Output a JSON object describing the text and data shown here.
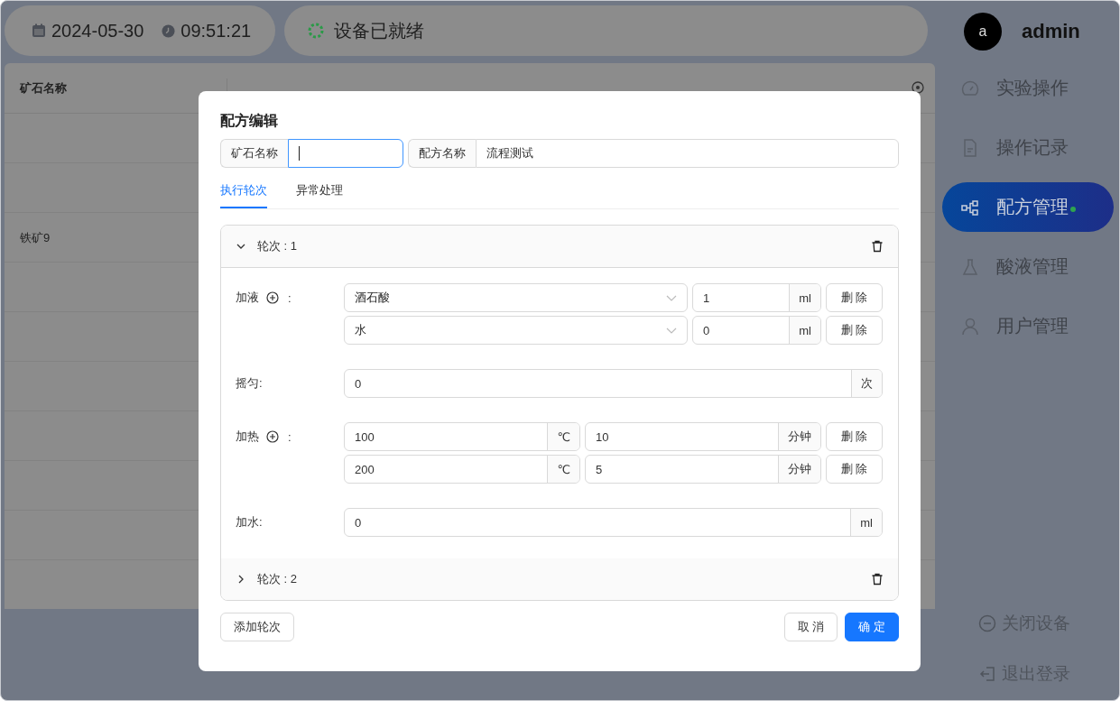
{
  "top_bar": {
    "date": "2024-05-30",
    "time": "09:51:21",
    "status": "设备已就绪"
  },
  "user": {
    "avatar": "a",
    "name": "admin"
  },
  "nav": [
    {
      "label": "实验操作",
      "selected": false
    },
    {
      "label": "操作记录",
      "selected": false
    },
    {
      "label": "配方管理",
      "selected": true
    },
    {
      "label": "酸液管理",
      "selected": false
    },
    {
      "label": "用户管理",
      "selected": false
    }
  ],
  "nav_footer": [
    {
      "label": "关闭设备"
    },
    {
      "label": "退出登录"
    }
  ],
  "table": {
    "columns": [
      "矿石名称"
    ],
    "rows": [
      {
        "column_1": "铁矿9"
      }
    ]
  },
  "dialog": {
    "title": "配方编辑",
    "fields": [
      {
        "label": "矿石名称",
        "focused": true
      },
      {
        "label": "配方名称",
        "value": "流程测试",
        "focused": false
      }
    ],
    "tabs": [
      {
        "label": "执行轮次",
        "selected": true
      },
      {
        "label": "异常处理",
        "selected": false
      }
    ],
    "rounds": [
      {
        "title": "轮次 : 1",
        "expanded": true,
        "steps": [
          {
            "kind": "liquid",
            "label": "加液",
            "colon": ":",
            "rows": [
              {
                "reagent": "酒石酸",
                "amount": "1",
                "unit": "ml",
                "delete": "删 除"
              },
              {
                "reagent": "水",
                "amount": "0",
                "unit": "ml",
                "delete": "删 除"
              }
            ]
          },
          {
            "kind": "single",
            "label": "摇匀:",
            "value": "0",
            "unit": "次"
          },
          {
            "kind": "heat",
            "label": "加热",
            "colon": ":",
            "rows": [
              {
                "temp": "100",
                "temp_unit": "℃",
                "duration": "10",
                "duration_unit": "分钟",
                "delete": "删 除"
              },
              {
                "temp": "200",
                "temp_unit": "℃",
                "duration": "5",
                "duration_unit": "分钟",
                "delete": "删 除"
              }
            ]
          },
          {
            "kind": "single",
            "label": "加水:",
            "value": "0",
            "unit": "ml"
          }
        ]
      },
      {
        "title": "轮次 : 2",
        "expanded": false
      }
    ],
    "add_button": "添加轮次",
    "cancel_button": "取 消",
    "ok_button": "确 定"
  }
}
